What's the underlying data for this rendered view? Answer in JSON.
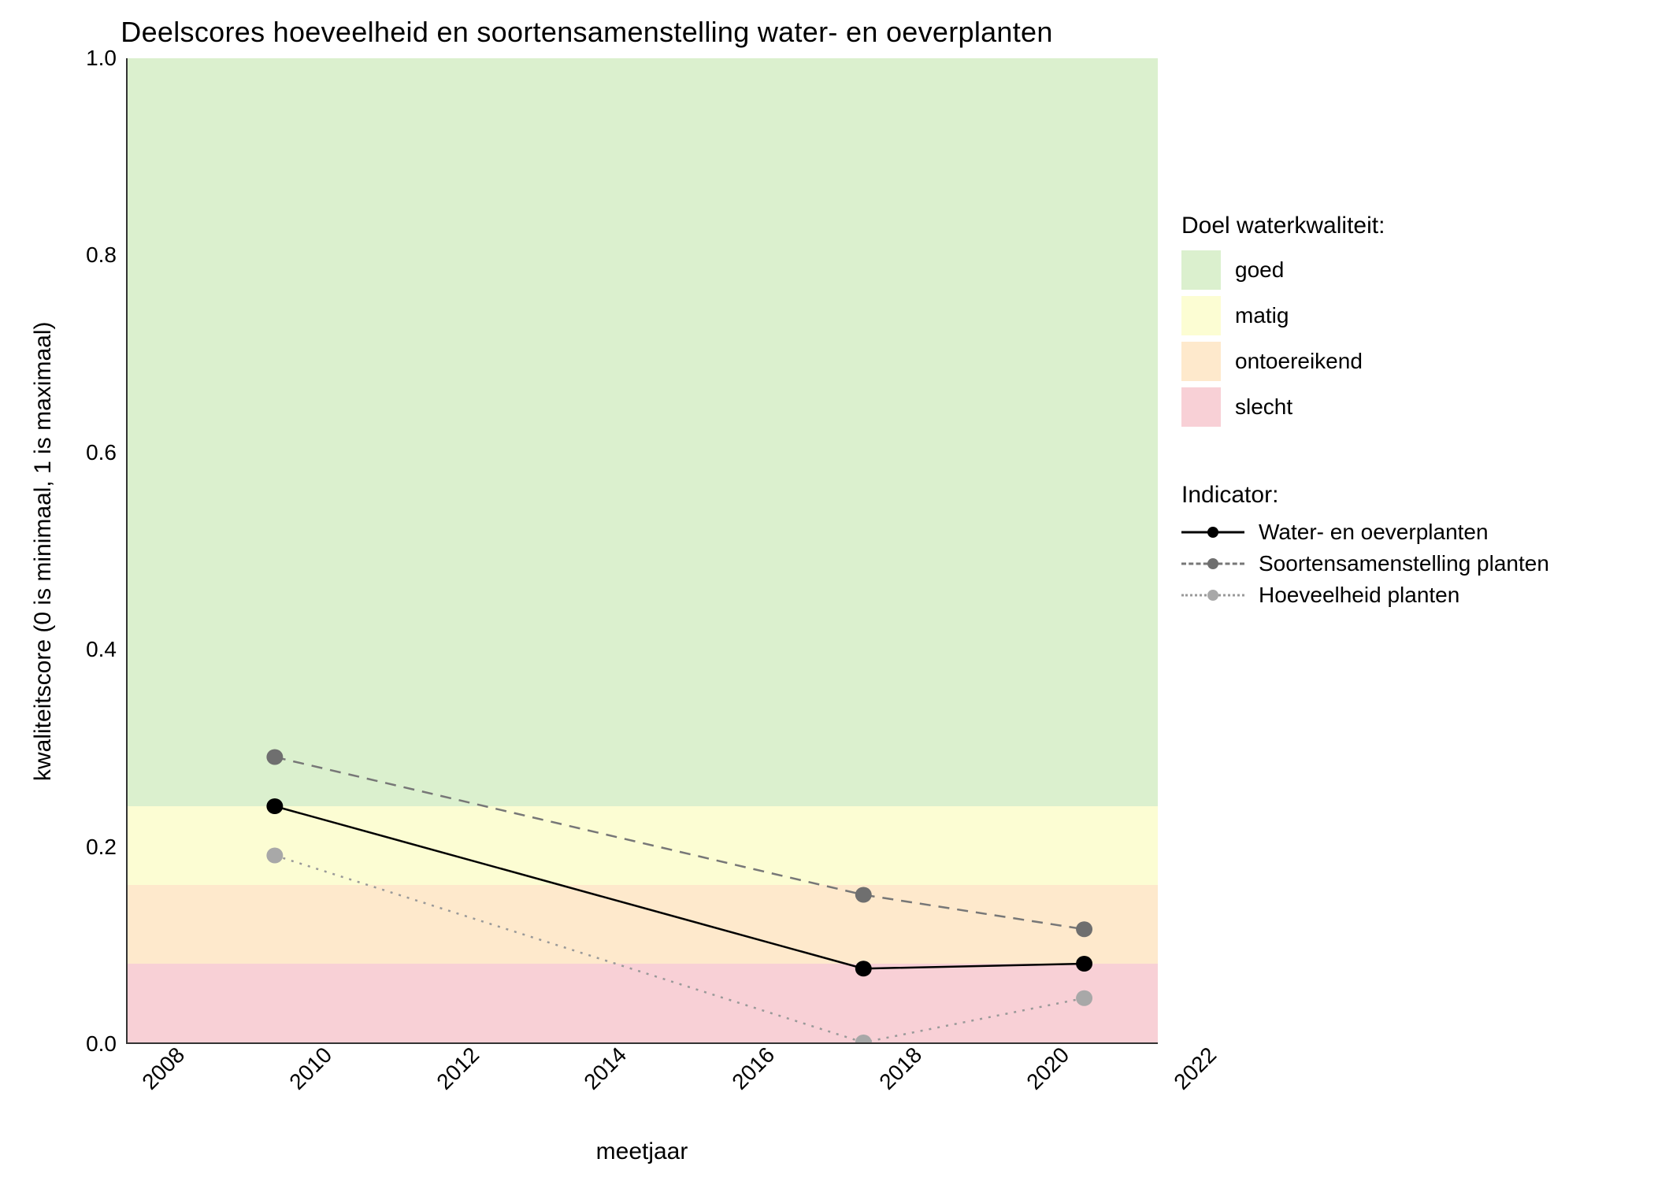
{
  "chart_data": {
    "type": "line",
    "title": "Deelscores hoeveelheid en soortensamenstelling water- en oeverplanten",
    "xlabel": "meetjaar",
    "ylabel": "kwaliteitscore (0 is minimaal, 1 is maximaal)",
    "xlim": [
      2008,
      2022
    ],
    "ylim": [
      0.0,
      1.0
    ],
    "x_ticks": [
      2008,
      2010,
      2012,
      2014,
      2016,
      2018,
      2020,
      2022
    ],
    "y_ticks": [
      0.0,
      0.2,
      0.4,
      0.6,
      0.8,
      1.0
    ],
    "bands": [
      {
        "name": "goed",
        "from": 0.24,
        "to": 1.0,
        "color": "#dbf0ce"
      },
      {
        "name": "matig",
        "from": 0.16,
        "to": 0.24,
        "color": "#fcfdd3"
      },
      {
        "name": "ontoereikend",
        "from": 0.08,
        "to": 0.16,
        "color": "#fee9cc"
      },
      {
        "name": "slecht",
        "from": 0.0,
        "to": 0.08,
        "color": "#f8d0d6"
      }
    ],
    "series": [
      {
        "name": "Water- en oeverplanten",
        "style": "solid",
        "point_color": "black",
        "points": [
          {
            "x": 2010,
            "y": 0.24
          },
          {
            "x": 2018,
            "y": 0.075
          },
          {
            "x": 2021,
            "y": 0.08
          }
        ]
      },
      {
        "name": "Soortensamenstelling planten",
        "style": "dashed",
        "point_color": "dark",
        "points": [
          {
            "x": 2010,
            "y": 0.29
          },
          {
            "x": 2018,
            "y": 0.15
          },
          {
            "x": 2021,
            "y": 0.115
          }
        ]
      },
      {
        "name": "Hoeveelheid planten",
        "style": "dotted",
        "point_color": "light",
        "points": [
          {
            "x": 2010,
            "y": 0.19
          },
          {
            "x": 2018,
            "y": 0.0
          },
          {
            "x": 2021,
            "y": 0.045
          }
        ]
      }
    ],
    "legend_quality_title": "Doel waterkwaliteit:",
    "legend_indicator_title": "Indicator:",
    "legend_quality": [
      "goed",
      "matig",
      "ontoereikend",
      "slecht"
    ]
  }
}
